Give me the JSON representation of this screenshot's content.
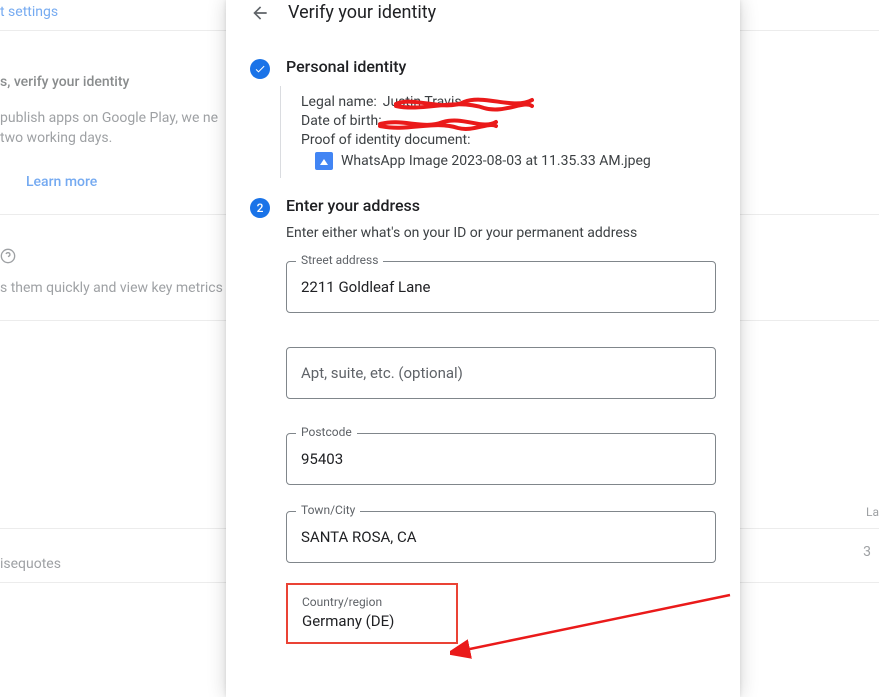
{
  "bg": {
    "settings": "t settings",
    "verify": "s, verify your identity",
    "publish": "publish apps on Google Play, we ne",
    "working": "two working days.",
    "learn": "Learn more",
    "metrics": "s them quickly and view key metrics",
    "la": "La",
    "isequotes": "isequotes",
    "three": "3"
  },
  "dialog": {
    "title": "Verify your identity",
    "section1": {
      "title": "Personal identity",
      "legal_label": "Legal name:",
      "legal_value": "Justin Travis",
      "dob_label": "Date of birth:",
      "dob_value": "",
      "proof_label": "Proof of identity document:",
      "file_name": "WhatsApp Image 2023-08-03 at 11.35.33 AM.jpeg"
    },
    "section2": {
      "number": "2",
      "title": "Enter your address",
      "hint": "Enter either what's on your ID or your permanent address",
      "street_label": "Street address",
      "street_value": "2211 Goldleaf Lane",
      "apt_placeholder": "Apt, suite, etc. (optional)",
      "apt_value": "",
      "postcode_label": "Postcode",
      "postcode_value": "95403",
      "town_label": "Town/City",
      "town_value": "SANTA ROSA, CA",
      "country_label": "Country/region",
      "country_value": "Germany (DE)"
    }
  }
}
